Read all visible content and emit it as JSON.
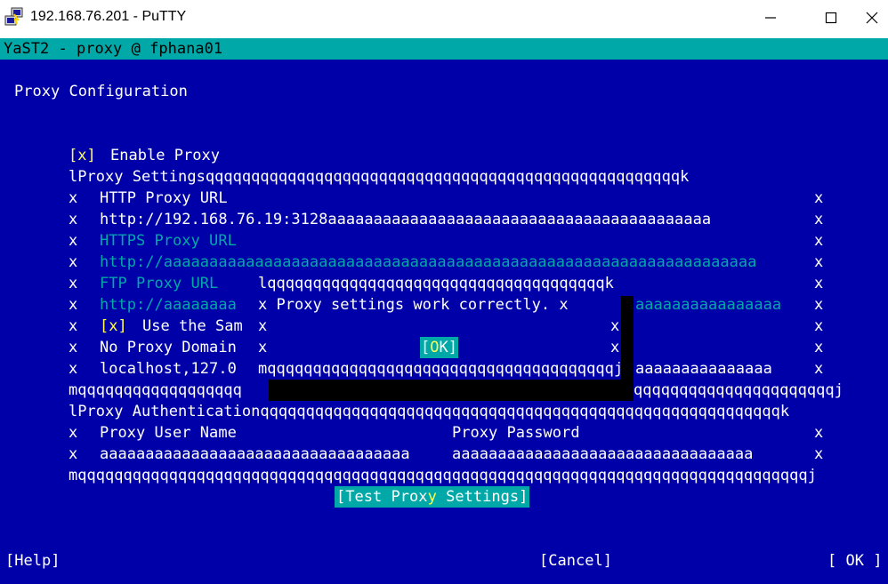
{
  "window": {
    "title": "192.168.76.201 - PuTTY",
    "icons": {
      "app": "putty-icon",
      "minimize": "minimize-icon",
      "maximize": "maximize-icon",
      "close": "close-icon"
    }
  },
  "yast": {
    "header": "YaST2 - proxy @ fphana01"
  },
  "page": {
    "title": "Proxy Configuration"
  },
  "enable_proxy": {
    "checkbox": "[x]",
    "label": "Enable Proxy"
  },
  "settings_frame": {
    "top": "lProxy Settingsqqqqqqqqqqqqqqqqqqqqqqqqqqqqqqqqqqqqqqqqqqqqqqqqqqqqk",
    "bottom_left": "mqqqqqqqqqqqqqqqqqq",
    "bottom_right": "qqqqqqqqqqqqqqqqqqqqqqj",
    "border": "x"
  },
  "http": {
    "label": "HTTP Proxy URL",
    "value": "http://192.168.76.19:3128",
    "fill": "aaaaaaaaaaaaaaaaaaaaaaaaaaaaaaaaaaaaaaaaaa"
  },
  "https": {
    "label": "HTTPS Proxy URL",
    "value": "http://aaaaaaaaaaaaaaaaaaaaaaaaaaaaaaaaaaaaaaaaaaaaaaaaaaaaaaaaaaaaaaaaa"
  },
  "ftp": {
    "label": "FTP Proxy URL",
    "value": "http://aaaaaaaa",
    "value_tail": "aaaaaaaaaaaaaaaa"
  },
  "same_proxy": {
    "checkbox": "[x]",
    "label": "Use the Sam"
  },
  "no_proxy": {
    "label": "No Proxy Domain",
    "value": "localhost,127.0",
    "value_tail": "aaaaaaaaaaaaaaa"
  },
  "popup": {
    "top": "lqqqqqqqqqqqqqqqqqqqqqqqqqqqqqqqqqqqqqk",
    "message": "x Proxy settings work correctly. x",
    "side": "x",
    "ok_left": "[",
    "ok_hot": "O",
    "ok_right": "K]",
    "bottom": "mqqqqqqqqqqqqqqqqqqqqqqqqqqqqqqqqqqqqqqj"
  },
  "auth_frame": {
    "top": "lProxy Authenticationqqqqqqqqqqqqqqqqqqqqqqqqqqqqqqqqqqqqqqqqqqqqqqqqqqqqqqqqqk",
    "bottom": "mqqqqqqqqqqqqqqqqqqqqqqqqqqqqqqqqqqqqqqqqqqqqqqqqqqqqqqqqqqqqqqqqqqqqqqqqqqqqqqqqj"
  },
  "user": {
    "label": "Proxy User Name",
    "value": "aaaaaaaaaaaaaaaaaaaaaaaaaaaaaaaaaa"
  },
  "password": {
    "label": "Proxy Password",
    "value": "aaaaaaaaaaaaaaaaaaaaaaaaaaaaaaaaa"
  },
  "test_button": {
    "left": "[Test Prox",
    "hot": "y",
    "right": " Settings]"
  },
  "footer": {
    "help": "[Help]",
    "cancel": "[Cancel]",
    "ok": "[ OK ]"
  }
}
